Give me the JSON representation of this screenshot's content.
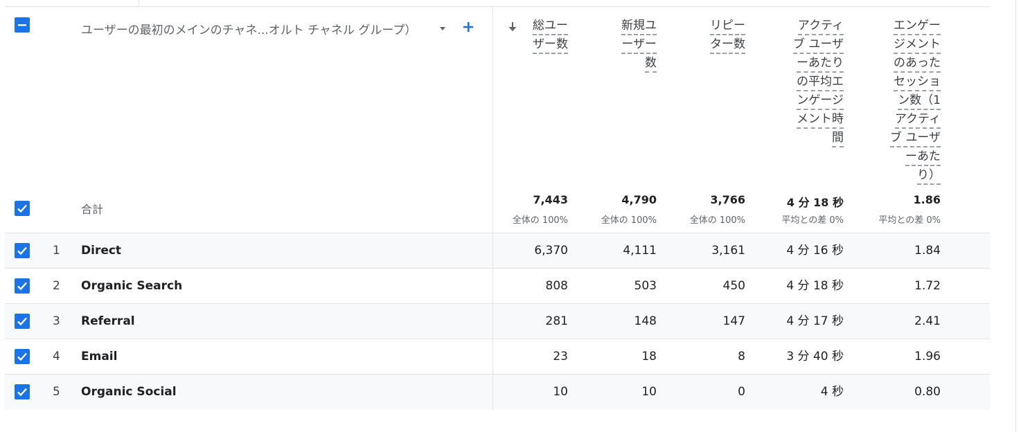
{
  "dimension": {
    "label": "ユーザーの最初のメインのチャネ...オルト チャネル グループ）"
  },
  "columns": [
    {
      "key": "total_users",
      "header_lines": [
        "総ユー",
        "ザー数"
      ]
    },
    {
      "key": "new_users",
      "header_lines": [
        "新規ユ",
        "ーザー",
        "数"
      ]
    },
    {
      "key": "returning_users",
      "header_lines": [
        "リピー",
        "ター数"
      ]
    },
    {
      "key": "avg_engagement",
      "header_lines": [
        "アクティ",
        "ブ ユーザ",
        "ーあたり",
        "の平均エ",
        "ンゲージ",
        "メント時",
        "間"
      ]
    },
    {
      "key": "engaged_sessions",
      "header_lines": [
        "エンゲー",
        "ジメント",
        "のあった",
        "セッショ",
        "ン数（1",
        "アクティ",
        "ブ ユーザ",
        "ーあた",
        "り）"
      ]
    }
  ],
  "totals": {
    "label": "合計",
    "values": [
      "7,443",
      "4,790",
      "3,766",
      "4 分 18 秒",
      "1.86"
    ],
    "subs": [
      "全体の 100%",
      "全体の 100%",
      "全体の 100%",
      "平均との差 0%",
      "平均との差 0%"
    ]
  },
  "rows": [
    {
      "index": "1",
      "name": "Direct",
      "values": [
        "6,370",
        "4,111",
        "3,161",
        "4 分 16 秒",
        "1.84"
      ]
    },
    {
      "index": "2",
      "name": "Organic Search",
      "values": [
        "808",
        "503",
        "450",
        "4 分 18 秒",
        "1.72"
      ]
    },
    {
      "index": "3",
      "name": "Referral",
      "values": [
        "281",
        "148",
        "147",
        "4 分 17 秒",
        "2.41"
      ]
    },
    {
      "index": "4",
      "name": "Email",
      "values": [
        "23",
        "18",
        "8",
        "3 分 40 秒",
        "1.96"
      ]
    },
    {
      "index": "5",
      "name": "Organic Social",
      "values": [
        "10",
        "10",
        "0",
        "4 秒",
        "0.80"
      ]
    }
  ],
  "colors": {
    "accent": "#1a73e8",
    "row_alt": "#f8f9fa",
    "divider": "#e3e3e3"
  }
}
